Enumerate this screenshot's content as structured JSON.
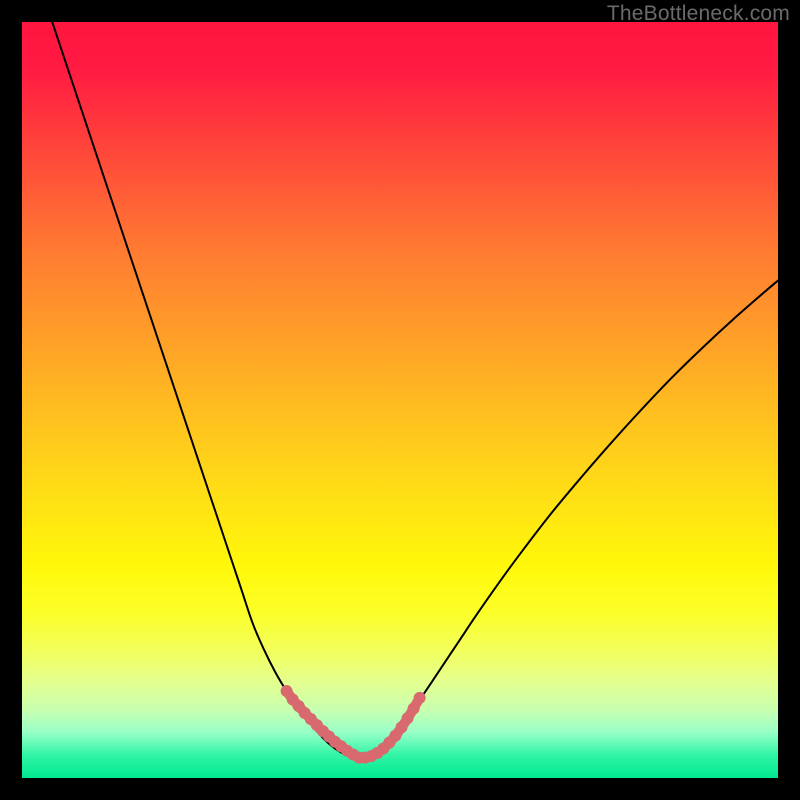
{
  "watermark": "TheBottleneck.com",
  "colors": {
    "background": "#000000",
    "gradient_top": "#ff153f",
    "gradient_bottom": "#00e890",
    "curve_stroke": "#000000",
    "marker_stroke": "#d86a6f",
    "marker_fill": "#d86a6f"
  },
  "chart_data": {
    "type": "line",
    "title": "",
    "xlabel": "",
    "ylabel": "",
    "xlim": [
      0,
      100
    ],
    "ylim": [
      0,
      100
    ],
    "grid": false,
    "legend": false,
    "series": [
      {
        "name": "curve-left",
        "x": [
          4,
          5,
          7,
          9,
          11,
          13,
          15,
          17,
          19,
          21,
          23,
          25,
          27,
          29,
          30.5,
          32,
          33.5,
          35,
          36.5,
          38,
          39,
          40,
          41,
          42,
          43,
          44
        ],
        "y": [
          100,
          97,
          91,
          85,
          79,
          73,
          67,
          61,
          55,
          49,
          43,
          37,
          31,
          25,
          20.5,
          17,
          14,
          11.5,
          9.5,
          7.5,
          6.2,
          5.1,
          4.2,
          3.5,
          3.0,
          2.6
        ]
      },
      {
        "name": "curve-right",
        "x": [
          44,
          45,
          46,
          47,
          48,
          49,
          50,
          51,
          52.5,
          54,
          56,
          58,
          60,
          63,
          66,
          70,
          74,
          78,
          82,
          86,
          90,
          94,
          98,
          100
        ],
        "y": [
          2.6,
          2.7,
          3.0,
          3.5,
          4.3,
          5.4,
          6.7,
          8.2,
          10.2,
          12.4,
          15.4,
          18.4,
          21.4,
          25.7,
          29.8,
          35.0,
          39.8,
          44.4,
          48.8,
          53.0,
          56.9,
          60.6,
          64.1,
          65.8
        ]
      },
      {
        "name": "minimum-markers",
        "x": [
          35.0,
          35.8,
          36.6,
          37.4,
          38.2,
          39.0,
          39.8,
          40.6,
          41.4,
          42.2,
          43.0,
          43.8,
          44.6,
          45.4,
          46.2,
          47.0,
          47.8,
          48.6,
          49.4,
          50.2,
          51.0,
          51.8,
          52.6
        ],
        "y": [
          11.5,
          10.4,
          9.5,
          8.6,
          7.8,
          7.0,
          6.2,
          5.5,
          4.8,
          4.2,
          3.6,
          3.1,
          2.7,
          2.7,
          2.9,
          3.3,
          3.9,
          4.7,
          5.6,
          6.7,
          7.9,
          9.2,
          10.6
        ]
      }
    ]
  }
}
